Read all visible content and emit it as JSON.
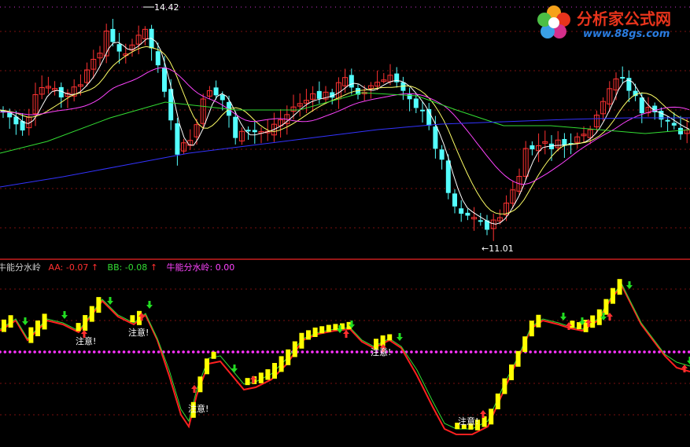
{
  "logo": {
    "name": "分析家公式网",
    "url": "www.88gs.com"
  },
  "colors": {
    "background": "#000000",
    "up_candle": "#ff3232",
    "down_candle": "#54ffff",
    "ma_white": "#ffffff",
    "ma_yellow": "#ffff66",
    "ma_magenta": "#ff44ff",
    "ma_green": "#33dd33",
    "ma_blue": "#3333ff",
    "divider": "#c81e1e",
    "aa_line": "#ff2020",
    "bb_line": "#33dd33",
    "watershed_dots": "#ff33ff",
    "yellow_bar": "#ffff00",
    "up_arrow": "#ff3030",
    "down_arrow": "#22dd22"
  },
  "price_chart": {
    "high_marker": "14.42",
    "low_marker": "←11.01"
  },
  "indicator_header": {
    "title": "牛能分水岭",
    "aa_label": "AA: -0.07",
    "aa_arrow": "↑",
    "bb_label": "BB: -0.08",
    "bb_arrow": "↑",
    "ws_label": "牛能分水岭: 0.00"
  },
  "annotations": [
    "注意!",
    "注意!",
    "注意!",
    "注意!",
    "注意!"
  ],
  "chart_data": [
    {
      "type": "candlestick",
      "description_series": [
        "price",
        "MA5",
        "MA10",
        "MA20",
        "MA60",
        "MA120"
      ],
      "price_range": [
        11.01,
        14.42
      ],
      "annotated_high": 14.42,
      "annotated_low": 11.01
    },
    {
      "type": "line",
      "title": "牛能分水岭",
      "series": [
        {
          "name": "AA",
          "last_value": -0.07
        },
        {
          "name": "BB",
          "last_value": -0.08
        },
        {
          "name": "牛能分水岭",
          "last_value": 0.0
        }
      ]
    }
  ]
}
